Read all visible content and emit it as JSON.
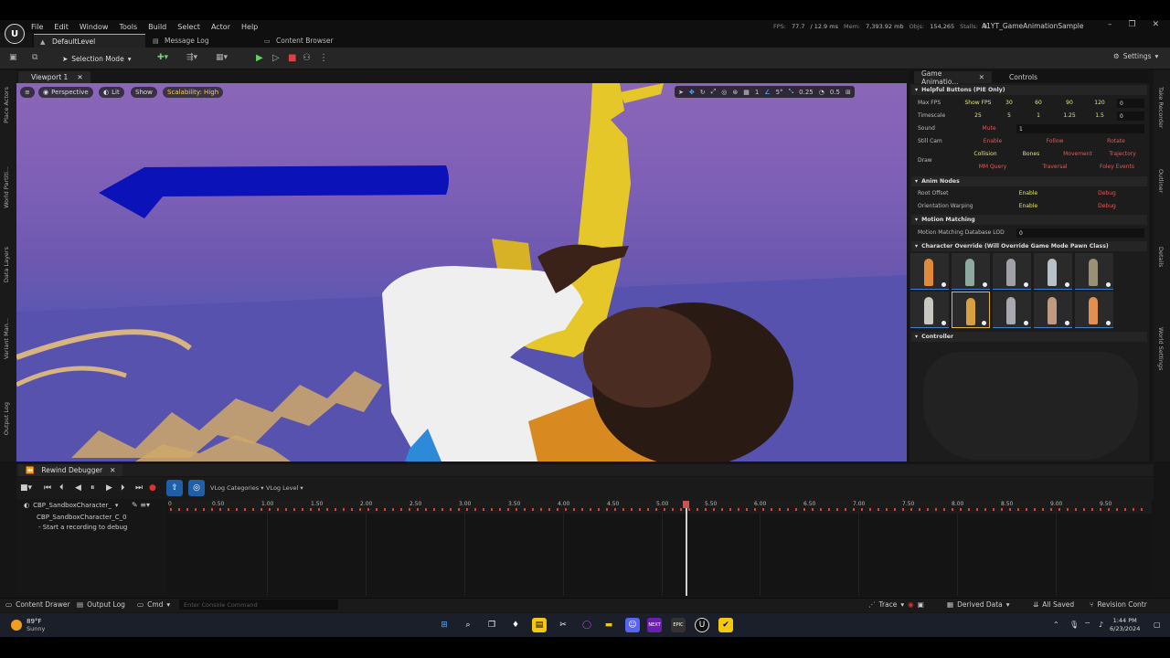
{
  "menu": [
    "File",
    "Edit",
    "Window",
    "Tools",
    "Build",
    "Select",
    "Actor",
    "Help"
  ],
  "stats": {
    "fps_label": "FPS:",
    "fps": "77.7",
    "ms": "/ 12.9 ms",
    "mem_label": "Mem:",
    "mem": "7,393.92 mb",
    "objs_label": "Objs:",
    "objs": "154,265",
    "stalls_label": "Stalls:",
    "stalls": "8"
  },
  "project": "A1YT_GameAnimationSample",
  "tabs": [
    "DefaultLevel",
    "Message Log",
    "Content Browser"
  ],
  "toolbar": {
    "selection_mode": "Selection Mode",
    "settings": "Settings"
  },
  "left_strip": [
    "Place Actors",
    "World Partiti...",
    "Data Layers",
    "Variant Man...",
    "Output Log"
  ],
  "right_strip": [
    "Take Recorder",
    "Outliner",
    "Details",
    "World Settings"
  ],
  "viewport": {
    "tab": "Viewport 1",
    "perspective": "Perspective",
    "lit": "Lit",
    "show": "Show",
    "scalability": "Scalability: High",
    "grid": "1",
    "angle": "5°",
    "scale": "0.25",
    "speed": "0.5"
  },
  "panel": {
    "tabs": [
      "Game Animatio...",
      "Controls"
    ],
    "sections": {
      "helpful": "Helpful Buttons (PIE Only)",
      "anim": "Anim Nodes",
      "mm": "Motion Matching",
      "char": "Character Override (Will Override Game Mode Pawn Class)",
      "controller": "Controller"
    },
    "rows": {
      "max_fps": {
        "label": "Max FPS",
        "items": [
          "Show FPS",
          "30",
          "60",
          "90",
          "120"
        ],
        "value": "0"
      },
      "timescale": {
        "label": "Timescale",
        "items": [
          "25",
          "5",
          "1",
          "1.25",
          "1.5"
        ],
        "value": "0"
      },
      "sound": {
        "label": "Sound",
        "items": [
          "Mute"
        ],
        "value": "1"
      },
      "still_cam": {
        "label": "Still Cam",
        "items": [
          "Enable",
          "Follow",
          "Rotate"
        ]
      },
      "draw": {
        "label": "Draw",
        "row1": [
          "Collision",
          "Bones",
          "Movement",
          "Trajectory"
        ],
        "row2": [
          "MM Query",
          "Traversal",
          "Foley Events"
        ]
      },
      "root_offset": {
        "label": "Root Offset",
        "enable": "Enable",
        "debug": "Debug"
      },
      "orient": {
        "label": "Orientation Warping",
        "enable": "Enable",
        "debug": "Debug"
      },
      "mm_lod": {
        "label": "Motion Matching Database LOD",
        "value": "0"
      }
    }
  },
  "rewind": {
    "tab": "Rewind Debugger",
    "vlog_cat": "VLog Categories",
    "vlog_level": "VLog Level",
    "track_main": "CBP_SandboxCharacter_",
    "track_child": "CBP_SandboxCharacter_C_0",
    "hint": "- Start a recording to debug",
    "ticks": [
      "0",
      "0.50",
      "1.00",
      "1.50",
      "2.00",
      "2.50",
      "3.00",
      "3.50",
      "4.00",
      "4.50",
      "5.00",
      "5.50",
      "6.00",
      "6.50",
      "7.00",
      "7.50",
      "8.00",
      "8.50",
      "9.00",
      "9.50"
    ]
  },
  "status": {
    "content_drawer": "Content Drawer",
    "output_log": "Output Log",
    "cmd": "Cmd",
    "console_ph": "Enter Console Command",
    "trace": "Trace",
    "derived": "Derived Data",
    "saved": "All Saved",
    "revision": "Revision Contr"
  },
  "taskbar": {
    "temp": "89°F",
    "weather": "Sunny",
    "time": "1:44 PM",
    "date": "6/23/2024"
  },
  "chart_data": {
    "type": "other"
  }
}
